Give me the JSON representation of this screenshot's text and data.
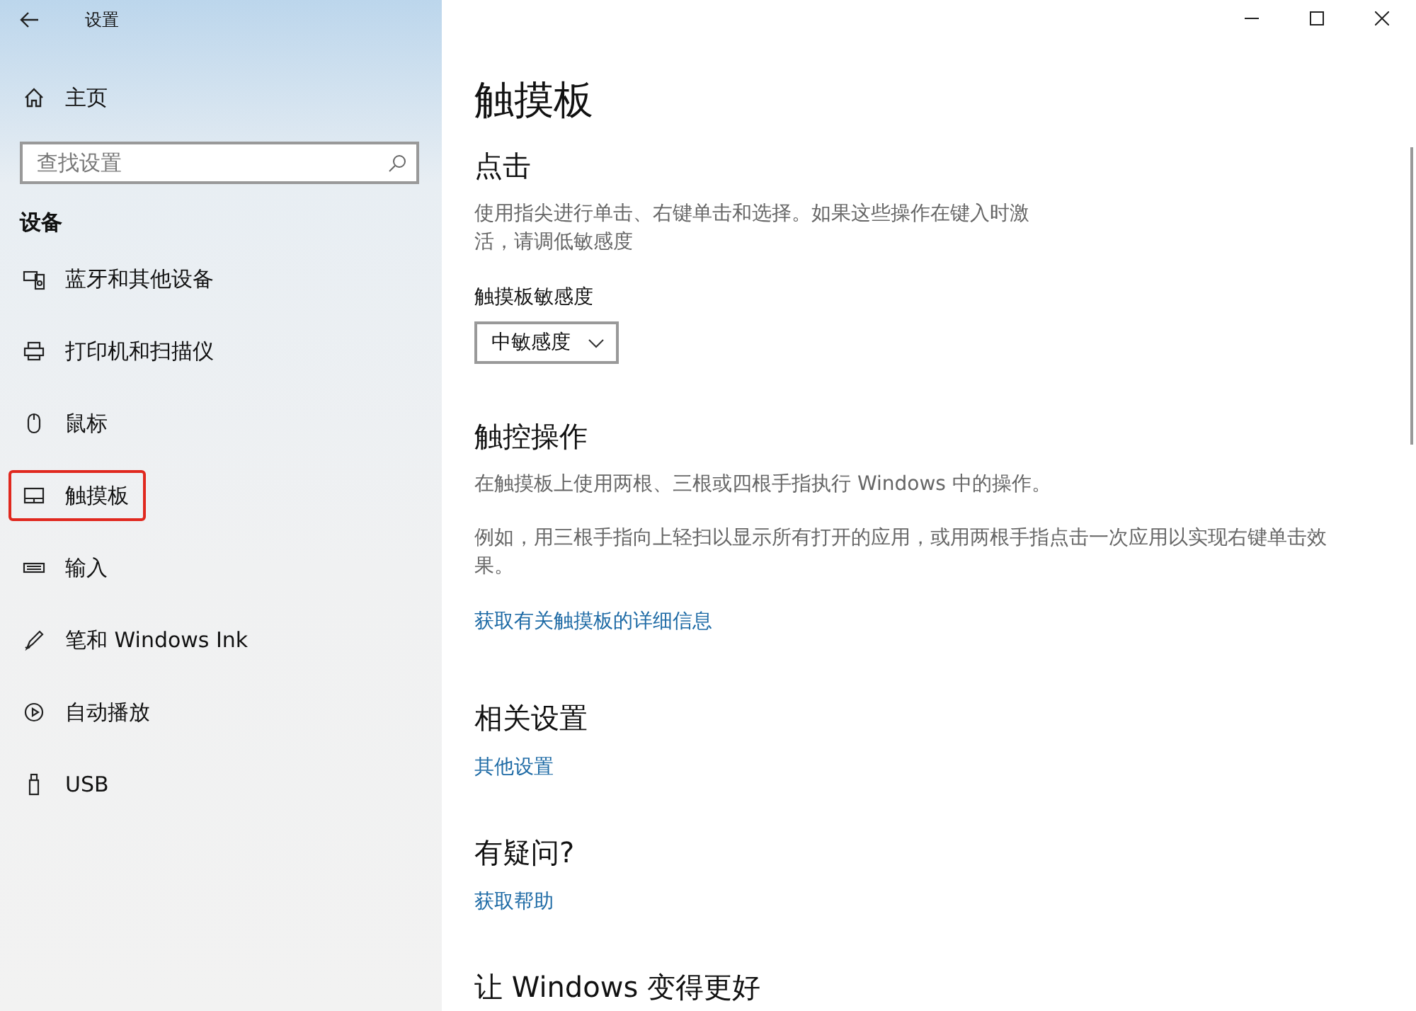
{
  "window": {
    "title": "设置"
  },
  "sidebar": {
    "home": "主页",
    "search": {
      "placeholder": "查找设置"
    },
    "section": "设备",
    "items": [
      {
        "label": "蓝牙和其他设备",
        "highlighted": false
      },
      {
        "label": "打印机和扫描仪",
        "highlighted": false
      },
      {
        "label": "鼠标",
        "highlighted": false
      },
      {
        "label": "触摸板",
        "highlighted": true
      },
      {
        "label": "输入",
        "highlighted": false
      },
      {
        "label": "笔和 Windows Ink",
        "highlighted": false
      },
      {
        "label": "自动播放",
        "highlighted": false
      },
      {
        "label": "USB",
        "highlighted": false
      }
    ]
  },
  "page": {
    "title": "触摸板",
    "sections": [
      {
        "heading": "点击",
        "paragraphs": [
          "使用指尖进行单击、右键单击和选择。如果这些操作在键入时激活，请调低敏感度"
        ],
        "dropdown": {
          "label": "触摸板敏感度",
          "value": "中敏感度"
        }
      },
      {
        "heading": "触控操作",
        "paragraphs": [
          "在触摸板上使用两根、三根或四根手指执行 Windows 中的操作。",
          "例如，用三根手指向上轻扫以显示所有打开的应用，或用两根手指点击一次应用以实现右键单击效果。"
        ],
        "link": "获取有关触摸板的详细信息"
      },
      {
        "heading": "相关设置",
        "link": "其他设置"
      },
      {
        "heading": "有疑问?",
        "link": "获取帮助"
      },
      {
        "heading": "让 Windows 变得更好"
      }
    ]
  }
}
